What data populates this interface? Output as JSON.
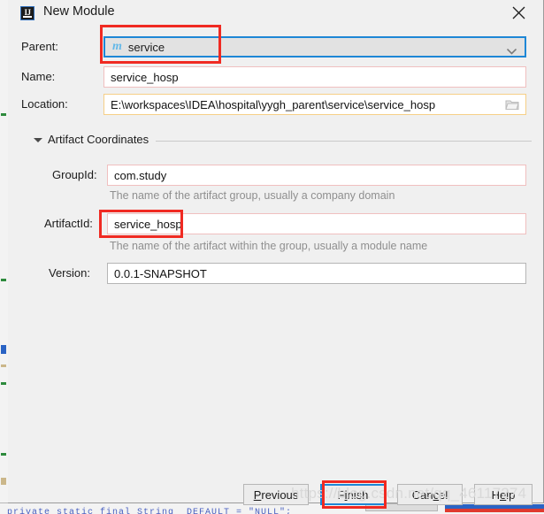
{
  "window": {
    "title": "New Module",
    "icon": "intellij-idea-icon",
    "close_label": "close-icon"
  },
  "form": {
    "parent": {
      "label": "Parent:",
      "value": "service",
      "icon": "maven-module-icon",
      "dropdown_icon": "chevron-down-icon"
    },
    "name": {
      "label": "Name:",
      "value": "service_hosp"
    },
    "location": {
      "label": "Location:",
      "value": "E:\\workspaces\\IDEA\\hospital\\yygh_parent\\service\\service_hosp",
      "browse_icon": "folder-icon"
    }
  },
  "artifact_section": {
    "title": "Artifact Coordinates",
    "twisty_icon": "triangle-down-icon",
    "group_id": {
      "label": "GroupId:",
      "value": "com.study",
      "hint": "The name of the artifact group, usually a company domain"
    },
    "artifact_id": {
      "label": "ArtifactId:",
      "value": "service_hosp",
      "hint": "The name of the artifact within the group, usually a module name"
    },
    "version": {
      "label": "Version:",
      "value": "0.0.1-SNAPSHOT"
    }
  },
  "buttons": {
    "previous": {
      "mnemonic": "P",
      "rest": "revious"
    },
    "finish": {
      "pre": "F",
      "mnemonic": "i",
      "rest": "nish"
    },
    "cancel": {
      "pre": "Can",
      "mnemonic": "c",
      "rest": "el"
    },
    "help": {
      "pre": "H",
      "mnemonic": "e",
      "rest": "lp"
    }
  },
  "overlay": {
    "watermark": "https://blog.csdn.net/qq_46117274"
  },
  "colors": {
    "accent_focus": "#1e87d6",
    "annotation": "#f02a22",
    "warn_field_border": "#f0bfbf",
    "path_field_border": "#f6cf87",
    "dialog_bg": "#f0f0f0",
    "maven_icon": "#63b8e8"
  }
}
